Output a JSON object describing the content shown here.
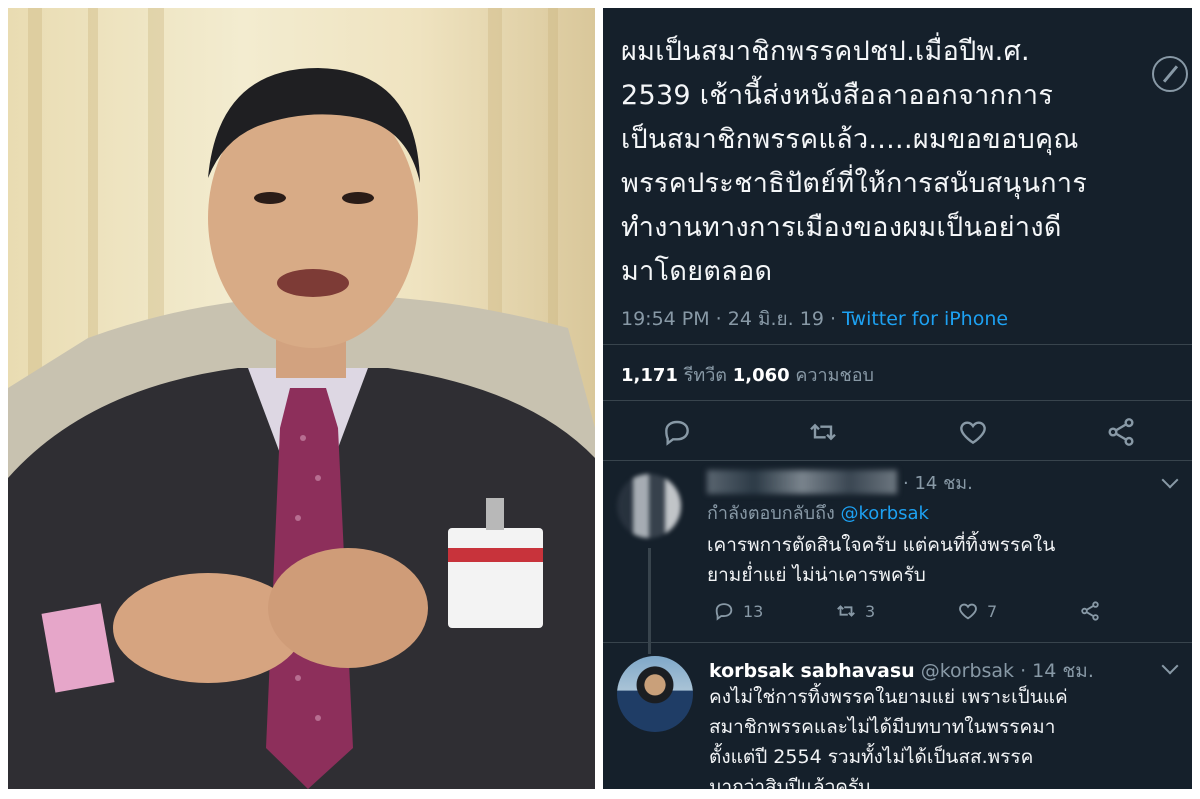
{
  "tweet": {
    "body": "ผมเป็นสมาชิกพรรคปชป.เมื่อปีพ.ศ.\n2539  เช้านี้ส่งหนังสือลาออกจากการ\nเป็นสมาชิกพรรคแล้ว.....ผมขอขอบคุณ\nพรรคประชาธิปัตย์ที่ให้การสนับสนุนการ\nทำงานทางการเมืองของผมเป็นอย่างดี\nมาโดยตลอด",
    "time": "19:54 PM · 24 มิ.ย. 19 · ",
    "source": "Twitter for iPhone",
    "retweets_count": "1,171",
    "retweets_label": " รีทวีต   ",
    "likes_count": "1,060",
    "likes_label": " ความชอบ"
  },
  "reply1": {
    "time": "· 14 ชม.",
    "replying_to_label": "กำลังตอบกลับถึง ",
    "replying_to_handle": "@korbsak",
    "text": "เคารพการตัดสินใจครับ  แต่คนที่ทิ้งพรรคใน\nยามย่ำแย่ ไม่น่าเคารพครับ",
    "reply_count": "13",
    "retweet_count": "3",
    "like_count": "7"
  },
  "reply2": {
    "name": "korbsak sabhavasu",
    "handle_time": " @korbsak · 14 ชม.",
    "text": "คงไม่ใช่การทิ้งพรรคในยามแย่  เพราะเป็นแค่\nสมาชิกพรรคและไม่ได้มีบทบาทในพรรคมา\nตั้งแต่ปี 2554    รวมทั้งไม่ได้เป็นสส.พรรค\nมากว่าสิบปีแล้วครับ"
  },
  "colors": {
    "background": "#15202b",
    "accent": "#1da1f2",
    "muted": "#8899a6"
  }
}
